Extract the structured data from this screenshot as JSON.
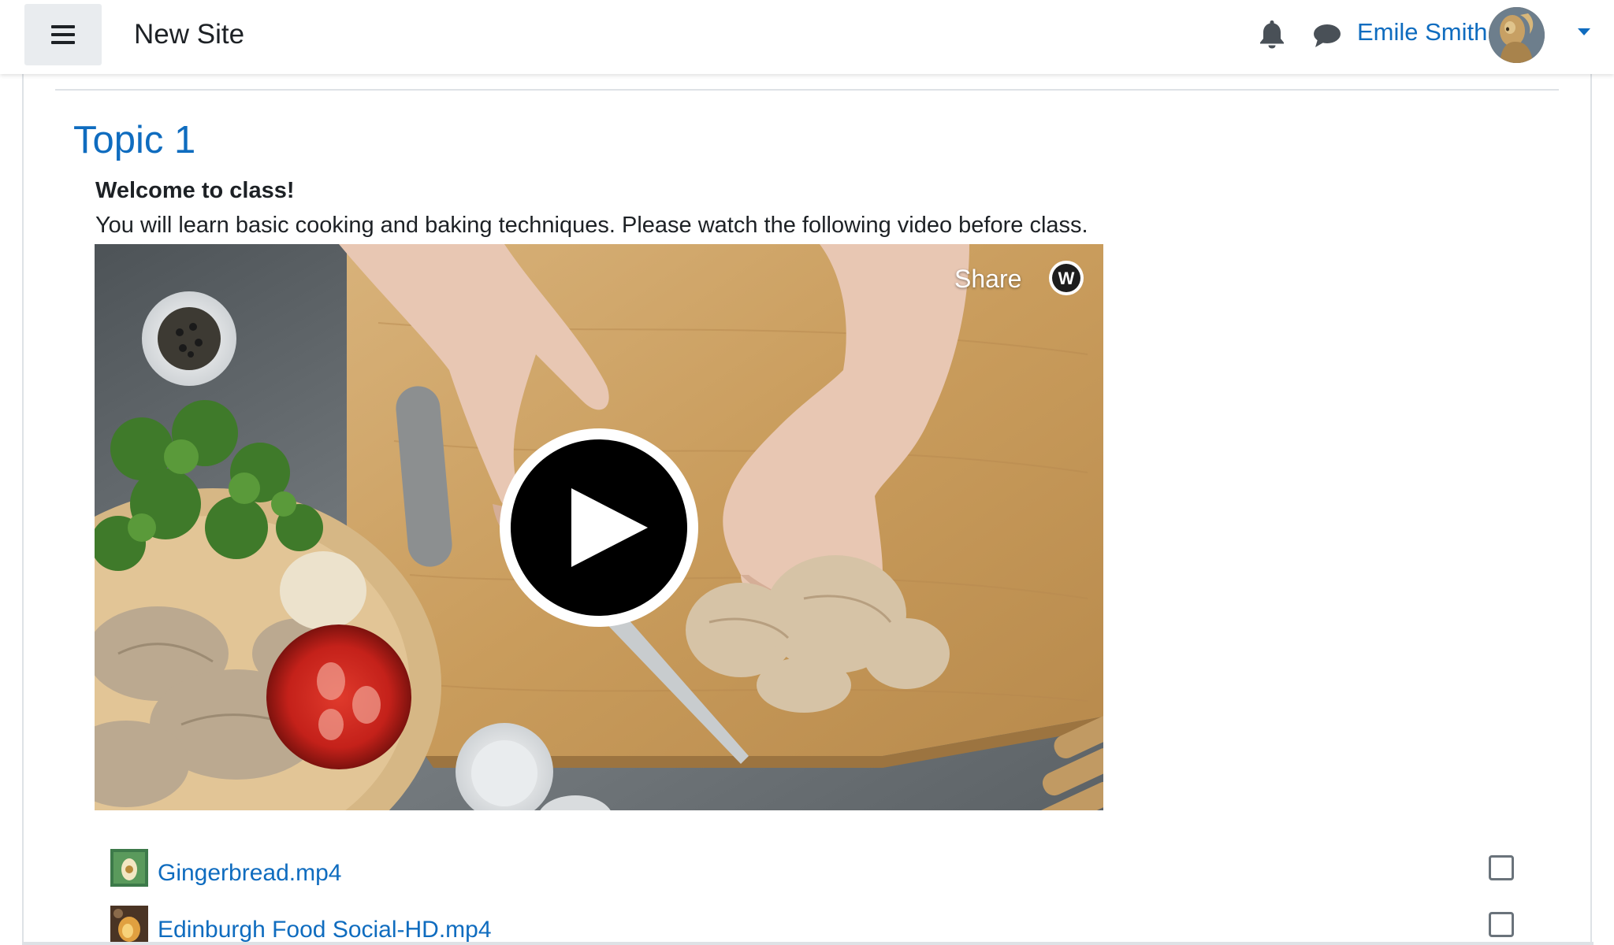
{
  "navbar": {
    "menu_icon": "hamburger-menu-icon",
    "site_name": "New Site",
    "notification_icon": "bell-icon",
    "messages_icon": "chat-bubble-icon",
    "user_name": "Emile Smith",
    "user_menu_icon": "caret-down-icon"
  },
  "section": {
    "title": "Topic 1",
    "welcome": "Welcome to class!",
    "intro": "You will learn basic cooking and baking techniques. Please watch the following video before class."
  },
  "video": {
    "share_label": "Share",
    "logo_letter": "W",
    "play_icon": "play-icon"
  },
  "activities": [
    {
      "name": "Gingerbread.mp4",
      "completed": false
    },
    {
      "name": "Edinburgh Food Social-HD.mp4",
      "completed": false
    }
  ],
  "colors": {
    "link": "#0f6cbf",
    "text": "#1d2125",
    "border": "#dee2e6",
    "menu_button_bg": "#e9ecef"
  }
}
